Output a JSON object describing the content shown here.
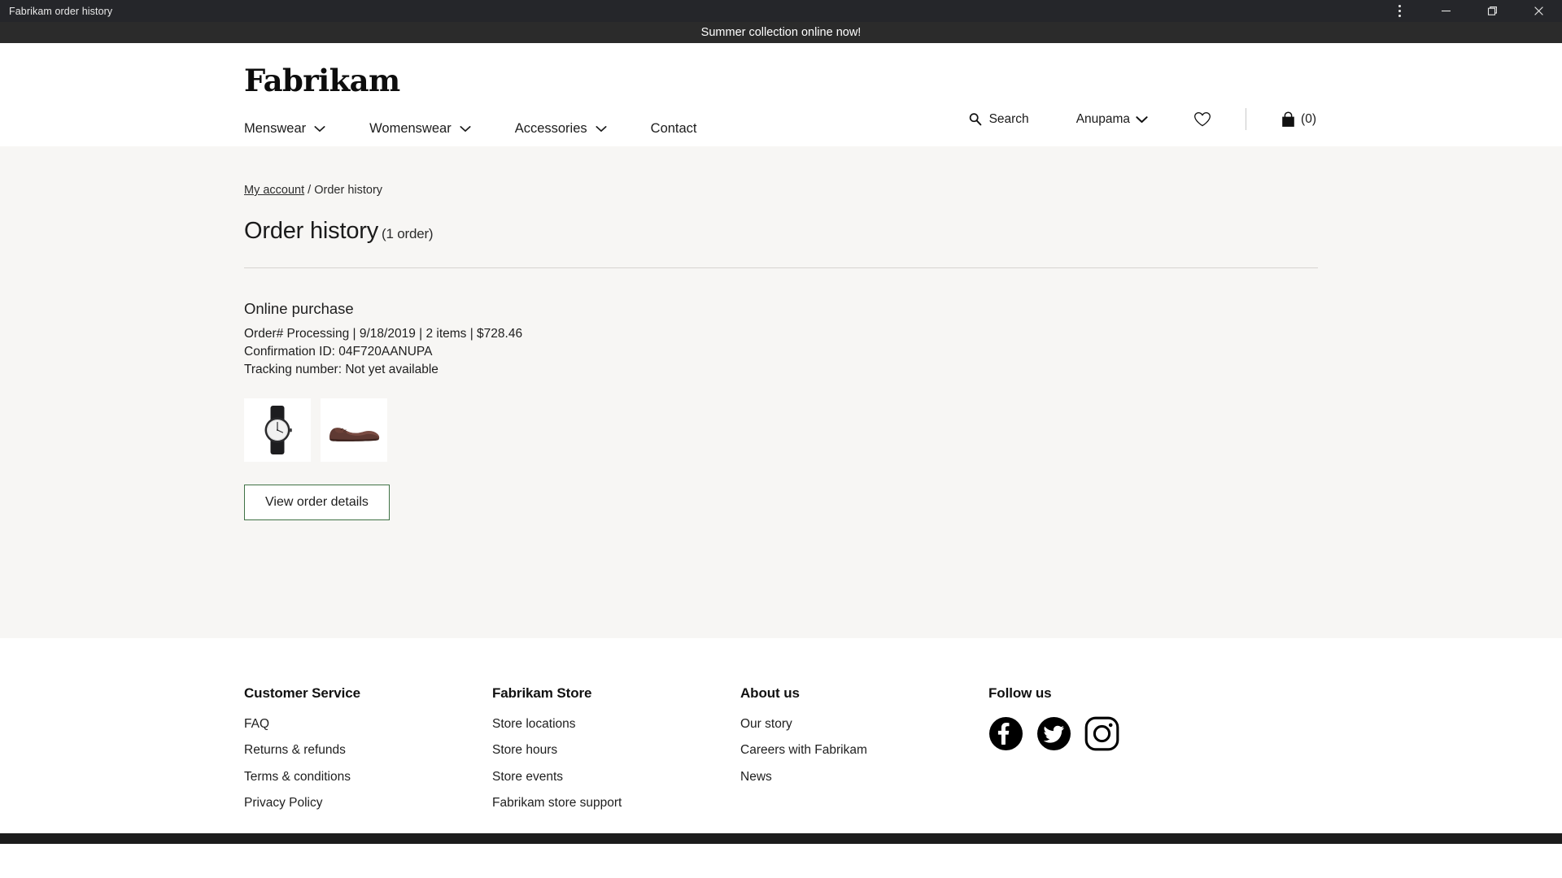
{
  "window": {
    "title": "Fabrikam order history",
    "controls": [
      {
        "name": "more-options",
        "glyph": "⋮"
      },
      {
        "name": "minimize",
        "glyph": "—"
      },
      {
        "name": "maximize",
        "glyph": "❐"
      },
      {
        "name": "close",
        "glyph": "✕"
      }
    ]
  },
  "promo": {
    "message": "Summer collection online now!",
    "background": "#2b2b2b",
    "color": "#ffffff"
  },
  "header": {
    "logo": "Fabrikam",
    "search_label": "Search",
    "account_label": "Anupama",
    "wishlist_label": "",
    "cart_count_label": "(0)"
  },
  "nav": {
    "items": [
      {
        "label": "Menswear",
        "has_menu": true
      },
      {
        "label": "Womenswear",
        "has_menu": true
      },
      {
        "label": "Accessories",
        "has_menu": true
      },
      {
        "label": "Contact",
        "has_menu": false
      }
    ]
  },
  "breadcrumb": {
    "parent": "My account",
    "separator": "/",
    "current": "Order history"
  },
  "page": {
    "title": "Order history",
    "count": "(1 order)"
  },
  "order": {
    "channel": "Online purchase",
    "summary": "Order# Processing | 9/18/2019 | 2 items | $728.46",
    "confirmation": "Confirmation ID: 04F720AANUPA",
    "tracking": "Tracking number: Not yet available",
    "items": [
      {
        "name": "wristwatch-thumbnail"
      },
      {
        "name": "dress-shoe-thumbnail"
      }
    ],
    "details_button": "View order details",
    "button_border_color": "#3f7245"
  },
  "footer": {
    "columns": [
      {
        "heading": "Customer Service",
        "links": [
          "FAQ",
          "Returns & refunds",
          "Terms & conditions",
          "Privacy Policy"
        ]
      },
      {
        "heading": "Fabrikam Store",
        "links": [
          "Store locations",
          "Store hours",
          "Store events",
          "Fabrikam store support"
        ]
      },
      {
        "heading": "About us",
        "links": [
          "Our story",
          "Careers with Fabrikam",
          "News"
        ]
      }
    ],
    "follow": {
      "heading": "Follow us",
      "socials": [
        "facebook-icon",
        "twitter-icon",
        "instagram-icon"
      ]
    }
  }
}
